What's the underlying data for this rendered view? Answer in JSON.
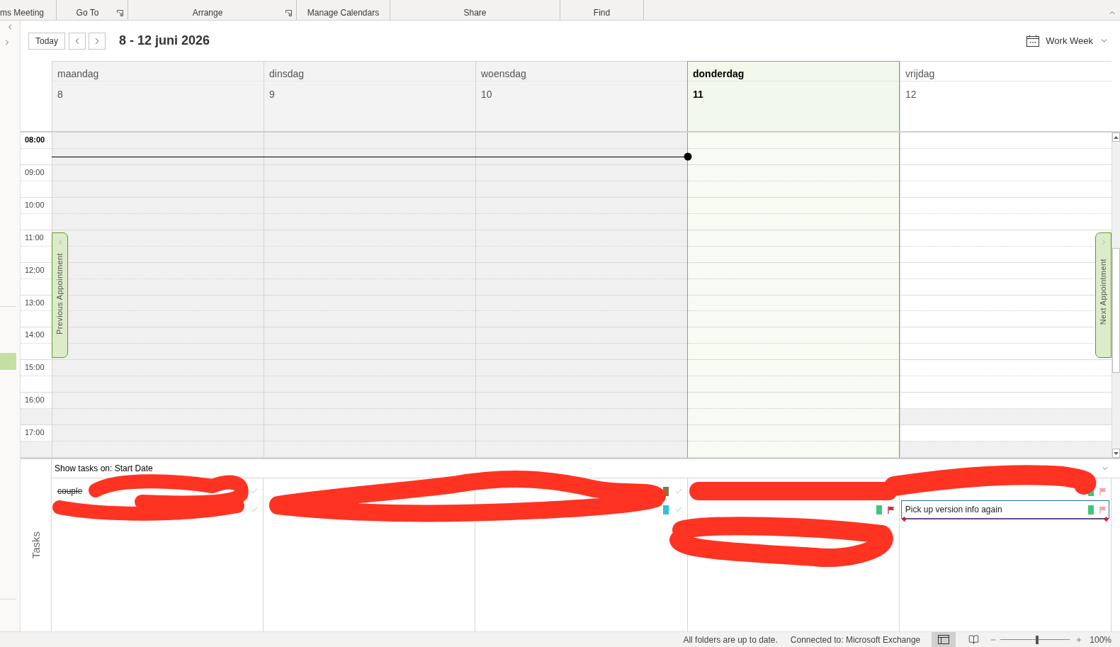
{
  "ribbon": {
    "groups": [
      {
        "label": "ms Meeting",
        "launcher": false
      },
      {
        "label": "Go To",
        "launcher": true
      },
      {
        "label": "Arrange",
        "launcher": true
      },
      {
        "label": "Manage Calendars",
        "launcher": false
      },
      {
        "label": "Share",
        "launcher": false
      },
      {
        "label": "Find",
        "launcher": false
      }
    ]
  },
  "navigation": {
    "today_button": "Today",
    "date_range": "8 - 12 juni 2026",
    "view_menu": "Work Week"
  },
  "days": [
    {
      "name": "maandag",
      "number": "8",
      "past": true,
      "today": false,
      "tasks": [
        {
          "kind": "task",
          "text": "couple",
          "completed": true,
          "flagged": false,
          "selected": false
        },
        {
          "kind": "task",
          "completed": true,
          "flagged": false,
          "selected": false
        }
      ]
    },
    {
      "name": "dinsdag",
      "number": "9",
      "past": true,
      "today": false
    },
    {
      "name": "woensdag",
      "number": "10",
      "past": true,
      "today": false,
      "tasks": [
        {
          "kind": "task",
          "completed": true,
          "flagged": false,
          "color": "#8b7245",
          "selected": false
        },
        {
          "kind": "task",
          "completed": true,
          "flagged": false,
          "color": "#2cc3d9",
          "selected": false
        }
      ]
    },
    {
      "name": "donderdag",
      "number": "11",
      "past": false,
      "today": true,
      "tasks": [
        {
          "kind": "redacted"
        },
        {
          "kind": "task",
          "completed": false,
          "flagged": true,
          "color": "#3cc77a",
          "selected": false
        }
      ]
    },
    {
      "name": "vrijdag",
      "number": "12",
      "past": false,
      "today": false,
      "tasks": [
        {
          "kind": "task",
          "completed": false,
          "flagged": true,
          "color": "#3cc77a",
          "selected": false
        },
        {
          "kind": "task",
          "text": "Pick up version info again",
          "completed": false,
          "flagged": true,
          "color": "#3cc77a",
          "selected": true
        }
      ]
    }
  ],
  "hours": [
    {
      "label": "08:00",
      "current": true,
      "slots": [
        {
          "shaded": false,
          "now": false
        },
        {
          "shaded": false,
          "now": true
        }
      ]
    },
    {
      "label": "09:00",
      "current": false,
      "slots": [
        {
          "shaded": false,
          "now": false
        },
        {
          "shaded": false,
          "now": false
        }
      ]
    },
    {
      "label": "10:00",
      "current": false,
      "slots": [
        {
          "shaded": false,
          "now": false
        },
        {
          "shaded": false,
          "now": false
        }
      ]
    },
    {
      "label": "11:00",
      "current": false,
      "slots": [
        {
          "shaded": false,
          "now": false
        },
        {
          "shaded": false,
          "now": false
        }
      ]
    },
    {
      "label": "12:00",
      "current": false,
      "slots": [
        {
          "shaded": false,
          "now": false
        },
        {
          "shaded": false,
          "now": false
        }
      ]
    },
    {
      "label": "13:00",
      "current": false,
      "slots": [
        {
          "shaded": false,
          "now": false
        },
        {
          "shaded": false,
          "now": false
        }
      ]
    },
    {
      "label": "14:00",
      "current": false,
      "slots": [
        {
          "shaded": false,
          "now": false
        },
        {
          "shaded": false,
          "now": false
        }
      ]
    },
    {
      "label": "15:00",
      "current": false,
      "slots": [
        {
          "shaded": false,
          "now": false
        },
        {
          "shaded": false,
          "now": false
        }
      ]
    },
    {
      "label": "16:00",
      "current": false,
      "slots": [
        {
          "shaded": false,
          "now": false
        },
        {
          "shaded": true,
          "now": false
        }
      ]
    },
    {
      "label": "17:00",
      "current": false,
      "slots": [
        {
          "shaded": false,
          "now": false
        },
        {
          "shaded": true,
          "now": false
        }
      ]
    }
  ],
  "appointment_tabs": {
    "previous": "Previous Appointment",
    "next": "Next Appointment"
  },
  "tasks_pane": {
    "title": "Tasks",
    "filter": "Show tasks on: Start Date"
  },
  "status_bar": {
    "sync": "All folders are up to date.",
    "connection": "Connected to: Microsoft Exchange",
    "views": [
      {
        "kind": "normal",
        "selected": true
      },
      {
        "kind": "reading",
        "selected": false
      }
    ],
    "zoom_slider": {
      "level": 0.53
    },
    "zoom": "100%"
  }
}
